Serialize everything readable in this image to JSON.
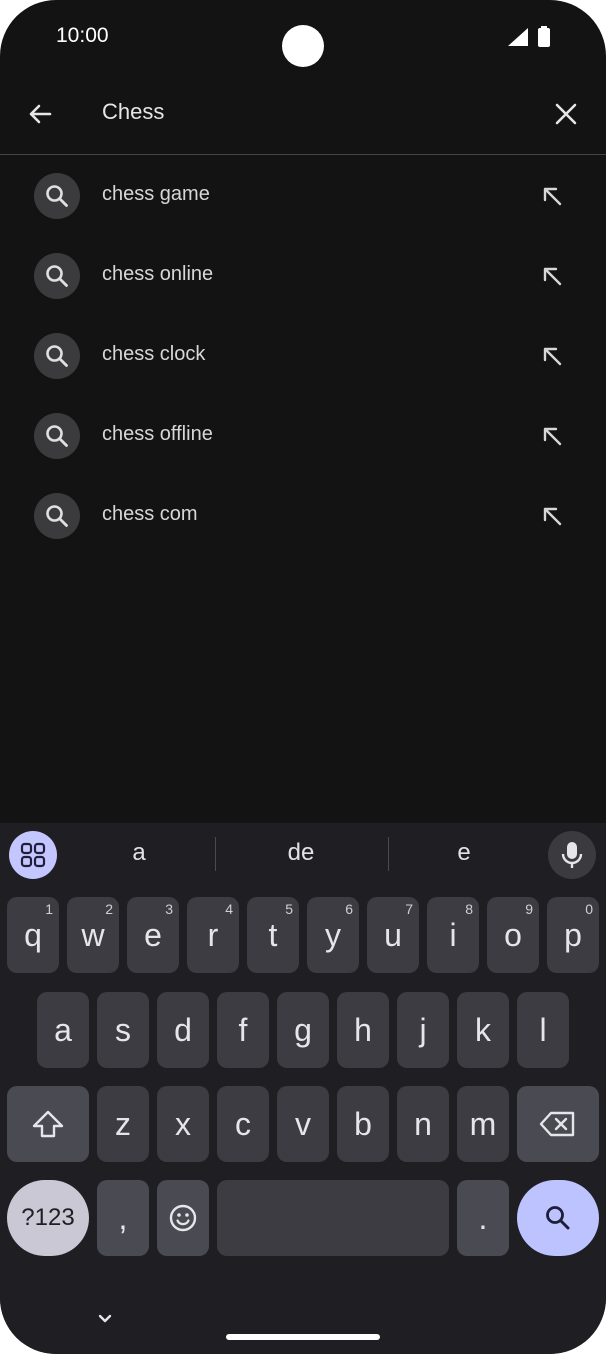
{
  "status": {
    "time": "10:00"
  },
  "search": {
    "query": "Chess"
  },
  "suggestions": [
    {
      "text": "chess game"
    },
    {
      "text": "chess online"
    },
    {
      "text": "chess clock"
    },
    {
      "text": "chess offline"
    },
    {
      "text": "chess com"
    }
  ],
  "keyboard": {
    "candidates": [
      "a",
      "de",
      "e"
    ],
    "row1": [
      {
        "k": "q",
        "h": "1"
      },
      {
        "k": "w",
        "h": "2"
      },
      {
        "k": "e",
        "h": "3"
      },
      {
        "k": "r",
        "h": "4"
      },
      {
        "k": "t",
        "h": "5"
      },
      {
        "k": "y",
        "h": "6"
      },
      {
        "k": "u",
        "h": "7"
      },
      {
        "k": "i",
        "h": "8"
      },
      {
        "k": "o",
        "h": "9"
      },
      {
        "k": "p",
        "h": "0"
      }
    ],
    "row2": [
      "a",
      "s",
      "d",
      "f",
      "g",
      "h",
      "j",
      "k",
      "l"
    ],
    "row3": [
      "z",
      "x",
      "c",
      "v",
      "b",
      "n",
      "m"
    ],
    "symbols_label": "?123",
    "comma": ",",
    "period": "."
  },
  "colors": {
    "background": "#131314",
    "keyboard": "#1f1f23",
    "key": "#3c3c42",
    "accent": "#bcc3ff"
  },
  "icons": {
    "back": "arrow-left-icon",
    "clear": "close-icon",
    "suggestion": "search-icon",
    "fill": "arrow-up-left-icon",
    "apps": "grid-icon",
    "mic": "mic-icon",
    "shift": "shift-icon",
    "backspace": "backspace-icon",
    "emoji": "emoji-icon",
    "enter": "search-icon",
    "hide_keyboard": "chevron-down-icon"
  }
}
